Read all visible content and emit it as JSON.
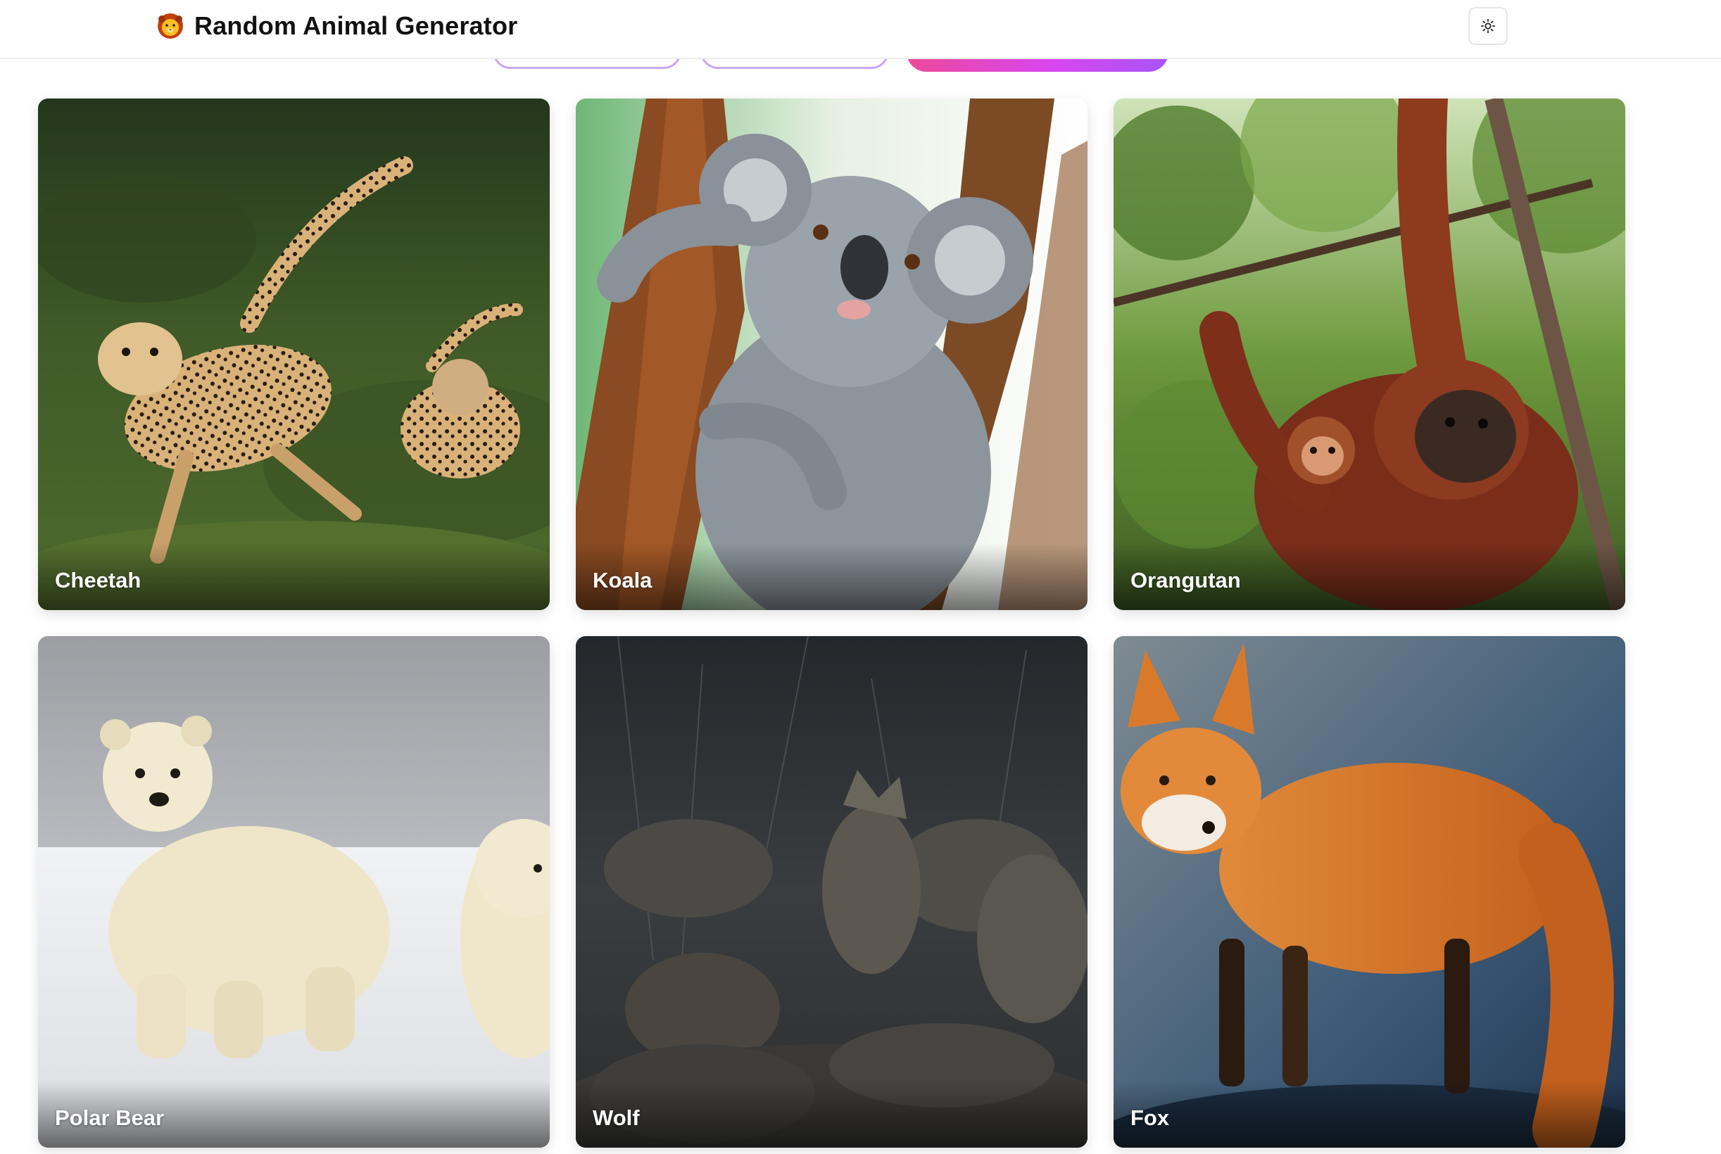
{
  "header": {
    "title": "Random Animal Generator",
    "logo_icon": "lion-face-icon",
    "theme_toggle_icon": "sun-icon"
  },
  "controls": {
    "select_1": "",
    "select_2": "",
    "generate_label": ""
  },
  "colors": {
    "accent_gradient_start": "#ec4899",
    "accent_gradient_end": "#a855f7",
    "pill_border": "#c9a7f4",
    "card_label": "#ffffff"
  },
  "animals": [
    {
      "name": "Cheetah"
    },
    {
      "name": "Koala"
    },
    {
      "name": "Orangutan"
    },
    {
      "name": "Polar Bear"
    },
    {
      "name": "Wolf"
    },
    {
      "name": "Fox"
    }
  ]
}
